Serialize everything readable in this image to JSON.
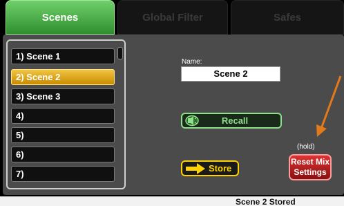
{
  "tabs": [
    {
      "label": "Scenes",
      "active": true
    },
    {
      "label": "Global Filter",
      "active": false
    },
    {
      "label": "Safes",
      "active": false
    }
  ],
  "scenes": {
    "items": [
      {
        "label": "1) Scene 1",
        "selected": false
      },
      {
        "label": "2) Scene 2",
        "selected": true
      },
      {
        "label": "3) Scene 3",
        "selected": false
      },
      {
        "label": "4)",
        "selected": false
      },
      {
        "label": "5)",
        "selected": false
      },
      {
        "label": "6)",
        "selected": false
      },
      {
        "label": "7)",
        "selected": false
      }
    ]
  },
  "name_field": {
    "label": "Name:",
    "value": "Scene 2"
  },
  "buttons": {
    "recall": "Recall",
    "store": "Store",
    "hold_hint": "(hold)",
    "reset_line1": "Reset Mix",
    "reset_line2": "Settings"
  },
  "status": {
    "message": "Scene 2 Stored"
  },
  "colors": {
    "active_tab": "#3aa83a",
    "selected_scene": "#e0a800",
    "recall": "#8fe08a",
    "store": "#ffd200",
    "reset": "#c62020",
    "annotation_arrow": "#e07a1a"
  },
  "icons": {
    "recall": "speaker-recall-icon",
    "store": "arrow-right-icon",
    "annotation": "orange-pointer-arrow"
  }
}
